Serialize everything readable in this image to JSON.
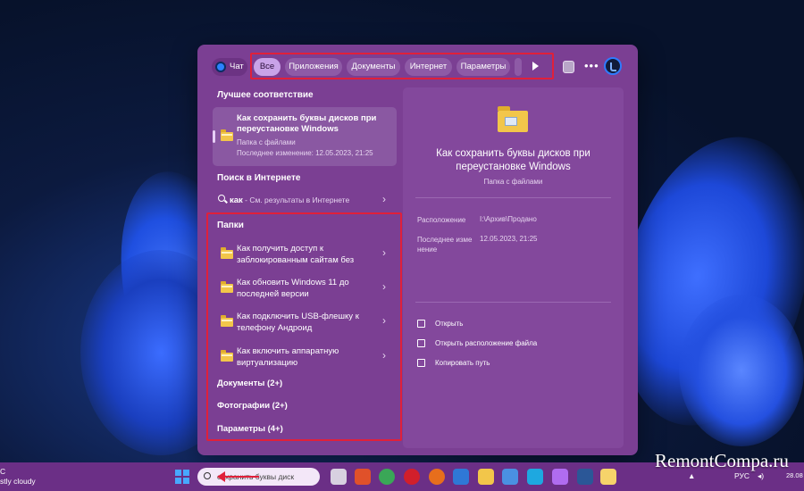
{
  "filter_bar": {
    "chat_label": "Чат",
    "chips": [
      {
        "label": "Все",
        "active": true
      },
      {
        "label": "Приложения",
        "active": false
      },
      {
        "label": "Документы",
        "active": false
      },
      {
        "label": "Интернет",
        "active": false
      },
      {
        "label": "Параметры",
        "active": false
      }
    ],
    "icons": [
      "play-icon",
      "clipboard-icon",
      "more-icon",
      "bing-icon"
    ]
  },
  "results": {
    "best_match_heading": "Лучшее соответствие",
    "best_match": {
      "title": "Как сохранить буквы дисков при переустановке Windows",
      "type": "Папка с файлами",
      "modified": "Последнее изменение: 12.05.2023, 21:25"
    },
    "web_heading": "Поиск в Интернете",
    "web_query": "как",
    "web_suffix": " - См. результаты в Интернете",
    "folders_heading": "Папки",
    "folders": [
      {
        "label": "Как получить доступ к заблокированным сайтам без"
      },
      {
        "label": "Как обновить Windows 11 до последней версии"
      },
      {
        "label": "Как подключить USB-флешку к телефону Андроид"
      },
      {
        "label": "Как включить аппаратную виртуализацию"
      }
    ],
    "categories": [
      {
        "label": "Документы (2+)"
      },
      {
        "label": "Фотографии (2+)"
      },
      {
        "label": "Параметры (4+)"
      }
    ]
  },
  "preview": {
    "title": "Как сохранить буквы дисков при переустановке Windows",
    "type": "Папка с файлами",
    "location_key": "Расположение",
    "location_val": "I:\\Архив\\Продано",
    "modified_key": "Последнее изме нение",
    "modified_val": "12.05.2023, 21:25",
    "actions": [
      {
        "label": "Открыть",
        "icon": "open-external-icon"
      },
      {
        "label": "Открыть расположение файла",
        "icon": "folder-open-icon"
      },
      {
        "label": "Копировать путь",
        "icon": "copy-icon"
      }
    ]
  },
  "taskbar": {
    "weather_line1": "C",
    "weather_line2": "stly cloudy",
    "search_text": "сохранить буквы диск",
    "tray": {
      "lang": "РУС",
      "time": "28.08"
    }
  },
  "watermark": "RemontCompa.ru",
  "colors": {
    "highlight_frame": "#e0203a",
    "panel": "#7b3f93",
    "accent_chip": "#c9a3e8"
  }
}
